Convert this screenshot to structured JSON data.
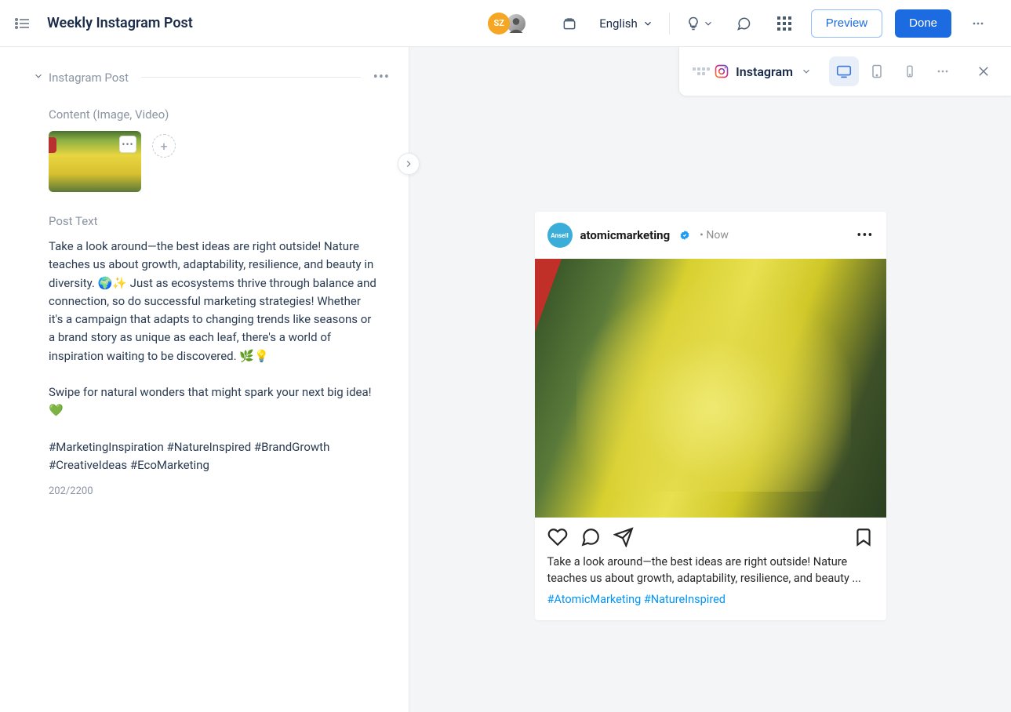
{
  "header": {
    "title": "Weekly Instagram Post",
    "avatar_initials": "SZ",
    "language": "English",
    "preview_label": "Preview",
    "done_label": "Done"
  },
  "editor": {
    "section_label": "Instagram Post",
    "content_label": "Content (Image, Video)",
    "post_text_label": "Post Text",
    "post_text": "Take a look around—the best ideas are right outside! Nature teaches us about growth, adaptability, resilience, and beauty in diversity. 🌍✨ Just as ecosystems thrive through balance and connection, so do successful marketing strategies! Whether it's a campaign that adapts to changing trends like seasons or a brand story as unique as each leaf, there's a world of inspiration waiting to be discovered. 🌿💡\n\nSwipe for natural wonders that might spark your next big idea! 💚\n\n#MarketingInspiration #NatureInspired #BrandGrowth #CreativeIdeas #EcoMarketing",
    "char_count": "202/2200"
  },
  "preview_bar": {
    "platform": "Instagram"
  },
  "ig_card": {
    "avatar_text": "Ansell",
    "username": "atomicmarketing",
    "time": "Now",
    "caption": "Take a look around—the best ideas are right outside! Nature teaches us about growth, adaptability, resilience, and beauty ...",
    "hashtag1": "#AtomicMarketing",
    "hashtag2": "#NatureInspired"
  }
}
